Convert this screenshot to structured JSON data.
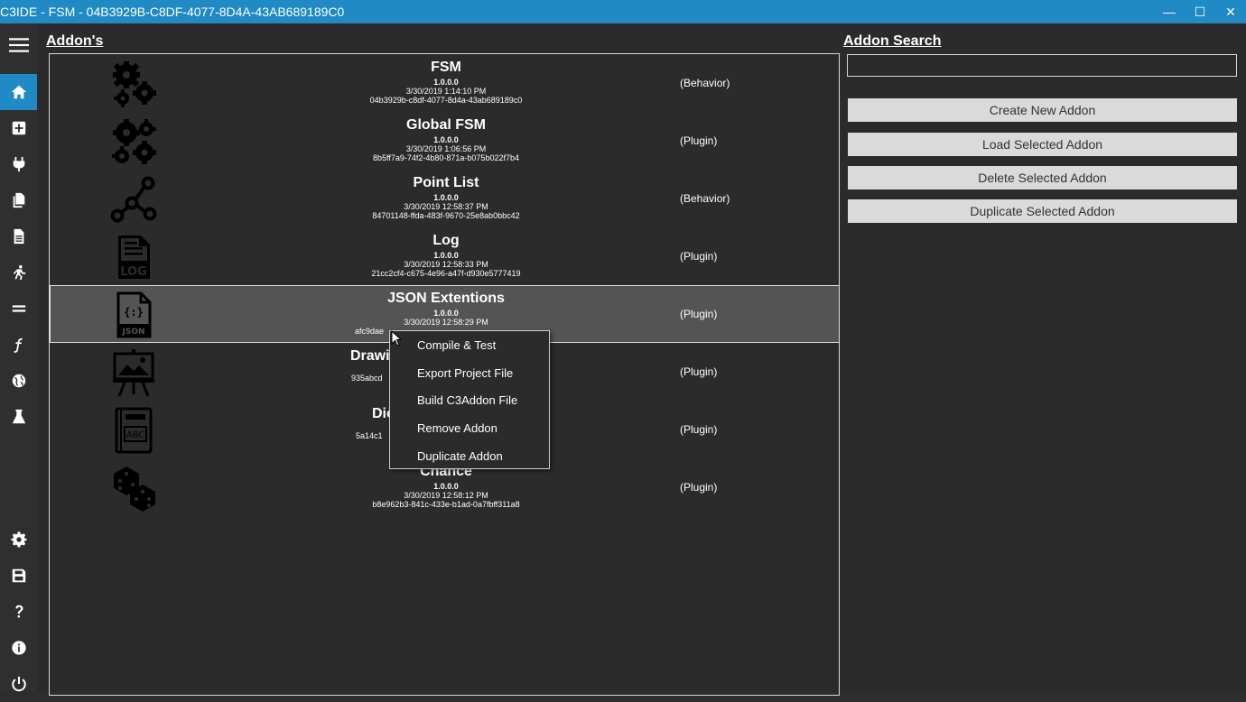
{
  "window": {
    "title": "C3IDE - FSM - 04B3929B-C8DF-4077-8D4A-43AB689189C0",
    "minimize_glyph": "—",
    "maximize_glyph": "☐",
    "close_glyph": "✕"
  },
  "sidebar": {
    "items": [
      {
        "icon": "hamburger-menu-icon"
      },
      {
        "icon": "home-icon",
        "active": true
      },
      {
        "icon": "add-icon"
      },
      {
        "icon": "plug-icon"
      },
      {
        "icon": "copy-files-icon"
      },
      {
        "icon": "document-icon"
      },
      {
        "icon": "running-icon"
      },
      {
        "icon": "equals-icon"
      },
      {
        "icon": "function-icon"
      },
      {
        "icon": "globe-icon"
      },
      {
        "icon": "flask-icon"
      },
      {
        "icon": "gear-icon"
      },
      {
        "icon": "save-icon"
      },
      {
        "icon": "help-icon"
      },
      {
        "icon": "info-icon"
      },
      {
        "icon": "power-icon"
      }
    ]
  },
  "addons_title": "Addon's",
  "search": {
    "title": "Addon Search",
    "value": "",
    "placeholder": ""
  },
  "actions": {
    "create": "Create New Addon",
    "load": "Load Selected Addon",
    "delete": "Delete Selected Addon",
    "duplicate": "Duplicate Selected Addon"
  },
  "addons": [
    {
      "name": "FSM",
      "version": "1.0.0.0",
      "date": "3/30/2019 1:14:10 PM",
      "id": "04b3929b-c8df-4077-8d4a-43ab689189c0",
      "type": "(Behavior)",
      "icon": "gears-icon"
    },
    {
      "name": "Global FSM",
      "version": "1.0.0.0",
      "date": "3/30/2019 1:06:56 PM",
      "id": "8b5ff7a9-74f2-4b80-871a-b075b022f7b4",
      "type": "(Plugin)",
      "icon": "gears-icon"
    },
    {
      "name": "Point List",
      "version": "1.0.0.0",
      "date": "3/30/2019 12:58:37 PM",
      "id": "84701148-ffda-483f-9670-25e8ab0bbc42",
      "type": "(Behavior)",
      "icon": "nodes-icon"
    },
    {
      "name": "Log",
      "version": "1.0.0.0",
      "date": "3/30/2019 12:58:33 PM",
      "id": "21cc2cf4-c675-4e96-a47f-d930e5777419",
      "type": "(Plugin)",
      "icon": "log-file-icon"
    },
    {
      "name": "JSON Extentions",
      "version": "1.0.0.0",
      "date": "3/30/2019 12:58:29 PM",
      "id": "afc9dae",
      "type": "(Plugin)",
      "icon": "json-file-icon",
      "selected": true
    },
    {
      "name": "Drawi",
      "version": "",
      "date": "",
      "id": "935abcd",
      "type": "(Plugin)",
      "icon": "easel-icon"
    },
    {
      "name": "Dic",
      "version": "",
      "date": "",
      "id": "5a14c1",
      "type": "(Plugin)",
      "icon": "dictionary-book-icon"
    },
    {
      "name": "Chance",
      "version": "1.0.0.0",
      "date": "3/30/2019 12:58:12 PM",
      "id": "b8e962b3-841c-433e-b1ad-0a7fbff311a8",
      "type": "(Plugin)",
      "icon": "dice-icon"
    }
  ],
  "context_menu": {
    "items": [
      "Compile & Test",
      "Export Project File",
      "Build C3Addon File",
      "Remove Addon",
      "Duplicate Addon"
    ]
  }
}
